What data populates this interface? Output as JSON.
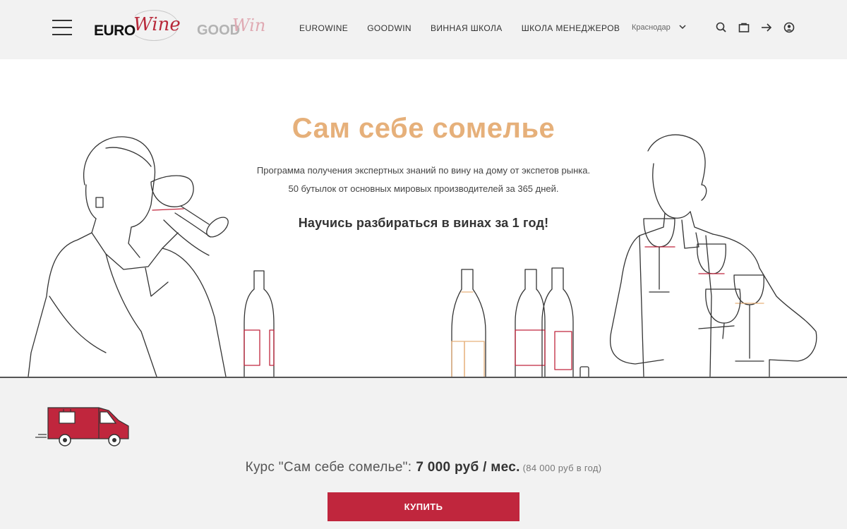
{
  "header": {
    "logo_euro_part1": "EURO",
    "logo_euro_part2": "Wine",
    "logo_good_part1": "GOOD",
    "logo_good_part2": "Win",
    "nav": [
      "EUROWINE",
      "GOODWIN",
      "ВИННАЯ ШКОЛА",
      "ШКОЛА МЕНЕДЖЕРОВ"
    ],
    "city": "Краснодар",
    "icons": [
      "search-icon",
      "bag-icon",
      "arrow-right-icon",
      "account-icon"
    ]
  },
  "hero": {
    "title": "Сам себе сомелье",
    "description_line1": "Программа получения экспертных знаний по вину на дому от экспетов рынка.",
    "description_line2": "50 бутылок от основных мировых производителей за 365 дней.",
    "cta_text": "Научись разбираться в винах за 1 год!"
  },
  "offer": {
    "course_label": "Курс \"Сам себе сомелье\":",
    "price_monthly": "7 000 руб / мес.",
    "price_yearly": "(84 000 руб в год)",
    "buy_label": "Купить"
  },
  "colors": {
    "accent": "#c0263d",
    "title": "#e6b07a",
    "header_bg": "#f2f2f2"
  }
}
